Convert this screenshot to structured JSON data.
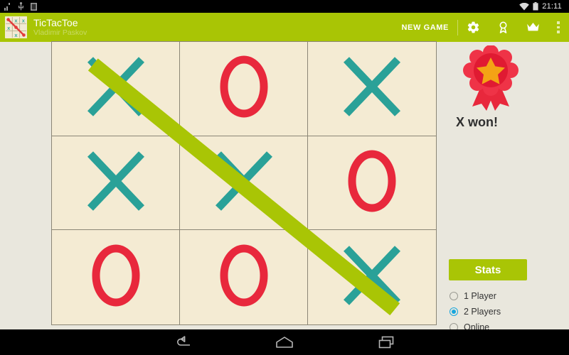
{
  "statusbar": {
    "clock": "21:11",
    "icons": [
      "signal-icon",
      "usb-icon",
      "sim-icon",
      "wifi-icon",
      "battery-icon"
    ]
  },
  "appbar": {
    "logo_icon": "tictactoe-logo-icon",
    "title": "TicTacToe",
    "subtitle": "Vladimir Paskov",
    "new_game_label": "NEW GAME",
    "actions": [
      {
        "name": "settings-button",
        "icon": "gear-icon"
      },
      {
        "name": "achievements-button",
        "icon": "award-ribbon-icon"
      },
      {
        "name": "leaderboard-button",
        "icon": "crown-icon"
      },
      {
        "name": "overflow-menu-button",
        "icon": "more-vertical-icon"
      }
    ],
    "background_color": "#a9c505"
  },
  "board": {
    "cells": [
      {
        "id": "r0c0",
        "mark": "X"
      },
      {
        "id": "r0c1",
        "mark": "O"
      },
      {
        "id": "r0c2",
        "mark": "X"
      },
      {
        "id": "r1c0",
        "mark": "X"
      },
      {
        "id": "r1c1",
        "mark": "X"
      },
      {
        "id": "r1c2",
        "mark": "O"
      },
      {
        "id": "r2c0",
        "mark": "O"
      },
      {
        "id": "r2c1",
        "mark": "O"
      },
      {
        "id": "r2c2",
        "mark": "X"
      }
    ],
    "x_color": "#2aa198",
    "o_color": "#e8283c",
    "cell_color": "#f4ebd3",
    "line_color": "#8b8676",
    "win_line": {
      "from": "r0c0",
      "to": "r2c2",
      "color": "#a9c505"
    }
  },
  "result": {
    "medal_icon": "award-rosette-icon",
    "text": "X won!"
  },
  "panel": {
    "stats_label": "Stats",
    "modes": [
      {
        "label": "1 Player",
        "selected": false
      },
      {
        "label": "2 Players",
        "selected": true
      },
      {
        "label": "Online",
        "selected": false
      }
    ],
    "selected_color": "#18a6dd"
  },
  "navbar": {
    "buttons": [
      {
        "name": "nav-back-button",
        "icon": "back-arrow-icon"
      },
      {
        "name": "nav-home-button",
        "icon": "home-icon"
      },
      {
        "name": "nav-recents-button",
        "icon": "recents-icon"
      }
    ]
  }
}
